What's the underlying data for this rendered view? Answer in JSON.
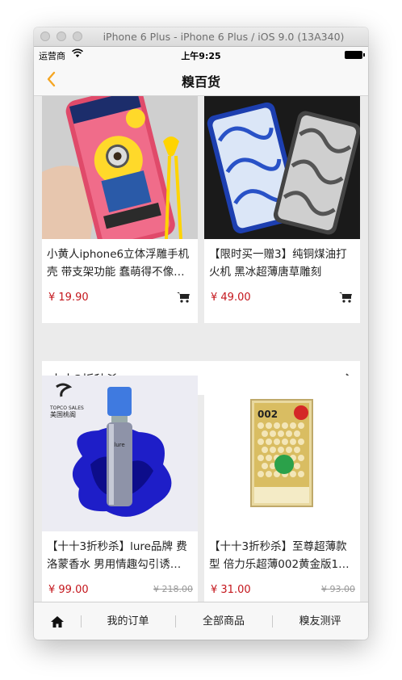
{
  "window": {
    "title": "iPhone 6 Plus - iPhone 6 Plus / iOS 9.0 (13A340)"
  },
  "status": {
    "carrier": "运营商",
    "time": "上午9:25"
  },
  "nav": {
    "title": "糗百货"
  },
  "colors": {
    "accent": "#f5a623",
    "price": "#c4161c",
    "background": "#ebebeb"
  },
  "products_top": [
    {
      "name": "小黄人iphone6立体浮雕手机壳 带支架功能 蠢萌得不像…",
      "price": "¥ 19.90"
    },
    {
      "name": "【限时买一赠3】纯铜煤油打火机 黑冰超薄唐草雕刻",
      "price": "¥ 49.00"
    }
  ],
  "sale_section": {
    "label": "十十3折秒杀"
  },
  "products_sale": [
    {
      "name": "【十十3折秒杀】lure品牌 费洛蒙香水 男用情趣勾引诱…",
      "price": "¥ 99.00",
      "old_price": "¥ 218.00",
      "brand_text": "TOPCO SALES",
      "brand_sub": "美国桃阁"
    },
    {
      "name": "【十十3折秒杀】至尊超薄款型 倍力乐超薄002黄金版1…",
      "price": "¥ 31.00",
      "old_price": "¥ 93.00",
      "box_text": "002"
    }
  ],
  "tabs": [
    {
      "icon": "home-icon"
    },
    {
      "label": "我的订单"
    },
    {
      "label": "全部商品"
    },
    {
      "label": "糗友测评"
    }
  ]
}
